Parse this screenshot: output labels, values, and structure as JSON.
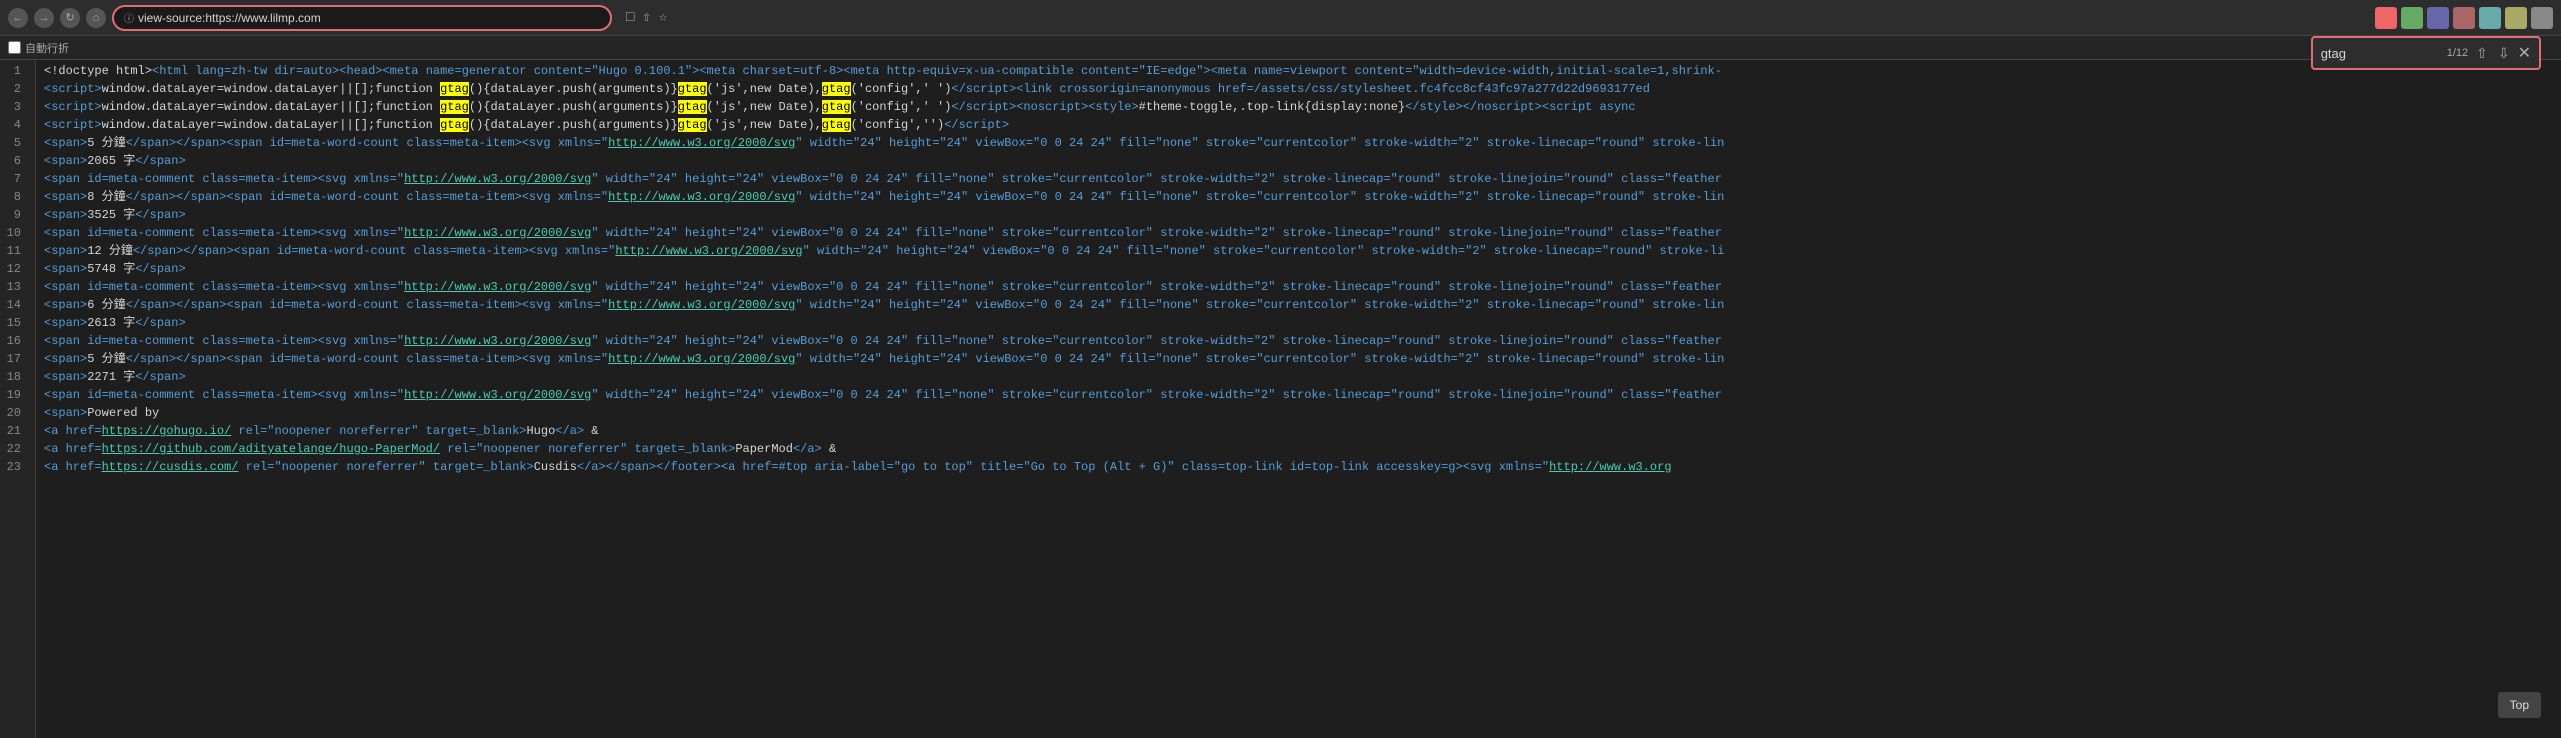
{
  "browser": {
    "url": "view-source:https://www.lilmp.com",
    "back_label": "←",
    "forward_label": "→",
    "reload_label": "↺",
    "home_label": "⌂"
  },
  "find": {
    "query": "gtag",
    "count": "1/12"
  },
  "autowrap": {
    "label": "自動行折 "
  },
  "top_button": "Top",
  "lines": [
    {
      "num": 1,
      "content": "&lt;!doctype html&gt;&lt;html lang=zh-tw dir=auto&gt;&lt;head&gt;&lt;meta name=generator content=\"Hugo 0.100.1\"&gt;&lt;meta charset=utf-8&gt;&lt;meta http-equiv=x-ua-compatible content=\"IE=edge\"&gt;&lt;meta name=viewport content=\"width=device-width,initial-scale=1,shrink-"
    },
    {
      "num": 2,
      "content": "&lt;script&gt;window.dataLayer=window.dataLayer||[];function <mark>gtag</mark>(){dataLayer.push(arguments)}<mark>gtag</mark>('js',new Date),<mark>gtag</mark>('config','         ')&lt;/script&gt;&lt;link crossorigin=anonymous href=/assets/css/stylesheet.fc4fcc8cf43fc97a277d22d9693177ed"
    },
    {
      "num": 3,
      "content": "&lt;script&gt;window.dataLayer=window.dataLayer||[];function <mark>gtag</mark>(){dataLayer.push(arguments)}<mark>gtag</mark>('js',new Date),<mark>gtag</mark>('config','         ')&lt;/script&gt;&lt;noscript&gt;&lt;style&gt;#theme-toggle,.top-link{display:none}&lt;/style&gt;&lt;/noscript&gt;&lt;script async"
    },
    {
      "num": 4,
      "content": "&lt;script&gt;window.dataLayer=window.dataLayer||[];function <mark>gtag</mark>(){dataLayer.push(arguments)}<mark>gtag</mark>('js',new Date),<mark>gtag</mark>('config','')&lt;/script&gt;"
    },
    {
      "num": 5,
      "content": "&lt;span&gt;5 分鐘&lt;/span&gt;&lt;/span&gt;&lt;span id=meta-word-count class=meta-item&gt;&lt;svg xmlns=\"http://www.w3.org/2000/svg\" width=\"24\" height=\"24\" viewBox=\"0 0 24 24\" fill=\"none\" stroke=\"currentcolor\" stroke-width=\"2\" stroke-linecap=\"round\" stroke-lin"
    },
    {
      "num": 6,
      "content": "&lt;span&gt;2065 字&lt;/span&gt;"
    },
    {
      "num": 7,
      "content": " &lt;span id=meta-comment class=meta-item&gt;&lt;svg xmlns=\"http://www.w3.org/2000/svg\" width=\"24\" height=\"24\" viewBox=\"0 0 24 24\" fill=\"none\" stroke=\"currentcolor\" stroke-width=\"2\" stroke-linecap=\"round\" stroke-linejoin=\"round\" class=\"feather"
    },
    {
      "num": 8,
      "content": "&lt;span&gt;8 分鐘&lt;/span&gt;&lt;/span&gt;&lt;span id=meta-word-count class=meta-item&gt;&lt;svg xmlns=\"http://www.w3.org/2000/svg\" width=\"24\" height=\"24\" viewBox=\"0 0 24 24\" fill=\"none\" stroke=\"currentcolor\" stroke-width=\"2\" stroke-linecap=\"round\" stroke-lin"
    },
    {
      "num": 9,
      "content": "&lt;span&gt;3525 字&lt;/span&gt;"
    },
    {
      "num": 10,
      "content": " &lt;span id=meta-comment class=meta-item&gt;&lt;svg xmlns=\"http://www.w3.org/2000/svg\" width=\"24\" height=\"24\" viewBox=\"0 0 24 24\" fill=\"none\" stroke=\"currentcolor\" stroke-width=\"2\" stroke-linecap=\"round\" stroke-linejoin=\"round\" class=\"feather"
    },
    {
      "num": 11,
      "content": "&lt;span&gt;12 分鐘&lt;/span&gt;&lt;/span&gt;&lt;span id=meta-word-count class=meta-item&gt;&lt;svg xmlns=\"http://www.w3.org/2000/svg\" width=\"24\" height=\"24\" viewBox=\"0 0 24 24\" fill=\"none\" stroke=\"currentcolor\" stroke-width=\"2\" stroke-linecap=\"round\" stroke-li"
    },
    {
      "num": 12,
      "content": "&lt;span&gt;5748 字&lt;/span&gt;"
    },
    {
      "num": 13,
      "content": " &lt;span id=meta-comment class=meta-item&gt;&lt;svg xmlns=\"http://www.w3.org/2000/svg\" width=\"24\" height=\"24\" viewBox=\"0 0 24 24\" fill=\"none\" stroke=\"currentcolor\" stroke-width=\"2\" stroke-linecap=\"round\" stroke-linejoin=\"round\" class=\"feather"
    },
    {
      "num": 14,
      "content": "&lt;span&gt;6 分鐘&lt;/span&gt;&lt;/span&gt;&lt;span id=meta-word-count class=meta-item&gt;&lt;svg xmlns=\"http://www.w3.org/2000/svg\" width=\"24\" height=\"24\" viewBox=\"0 0 24 24\" fill=\"none\" stroke=\"currentcolor\" stroke-width=\"2\" stroke-linecap=\"round\" stroke-lin"
    },
    {
      "num": 15,
      "content": "&lt;span&gt;2613 字&lt;/span&gt;"
    },
    {
      "num": 16,
      "content": " &lt;span id=meta-comment class=meta-item&gt;&lt;svg xmlns=\"http://www.w3.org/2000/svg\" width=\"24\" height=\"24\" viewBox=\"0 0 24 24\" fill=\"none\" stroke=\"currentcolor\" stroke-width=\"2\" stroke-linecap=\"round\" stroke-linejoin=\"round\" class=\"feather"
    },
    {
      "num": 17,
      "content": "&lt;span&gt;5 分鐘&lt;/span&gt;&lt;/span&gt;&lt;span id=meta-word-count class=meta-item&gt;&lt;svg xmlns=\"http://www.w3.org/2000/svg\" width=\"24\" height=\"24\" viewBox=\"0 0 24 24\" fill=\"none\" stroke=\"currentcolor\" stroke-width=\"2\" stroke-linecap=\"round\" stroke-lin"
    },
    {
      "num": 18,
      "content": "&lt;span&gt;2271 字&lt;/span&gt;"
    },
    {
      "num": 19,
      "content": " &lt;span id=meta-comment class=meta-item&gt;&lt;svg xmlns=\"http://www.w3.org/2000/svg\" width=\"24\" height=\"24\" viewBox=\"0 0 24 24\" fill=\"none\" stroke=\"currentcolor\" stroke-width=\"2\" stroke-linecap=\"round\" stroke-linejoin=\"round\" class=\"feather"
    },
    {
      "num": 20,
      "content": "&lt;span&gt;Powered by"
    },
    {
      "num": 21,
      "content": "  &lt;a href=https://gohugo.io/ rel=\"noopener noreferrer\" target=_blank&gt;Hugo&lt;/a&gt; &amp;"
    },
    {
      "num": 22,
      "content": "     &lt;a href=https://github.com/adityatelange/hugo-PaperMod/ rel=\"noopener noreferrer\" target=_blank&gt;PaperMod&lt;/a&gt; &amp;"
    },
    {
      "num": 23,
      "content": "       &lt;a href=https://cusdis.com/ rel=\"noopener noreferrer\" target=_blank&gt;Cusdis&lt;/a&gt;&lt;/span&gt;&lt;/footer&gt;&lt;a href=#top aria-label=\"go to top\" title=\"Go to Top (Alt + G)\" class=top-link id=top-link accesskey=g&gt;&lt;svg xmlns=\"http://www.w3.org"
    }
  ]
}
